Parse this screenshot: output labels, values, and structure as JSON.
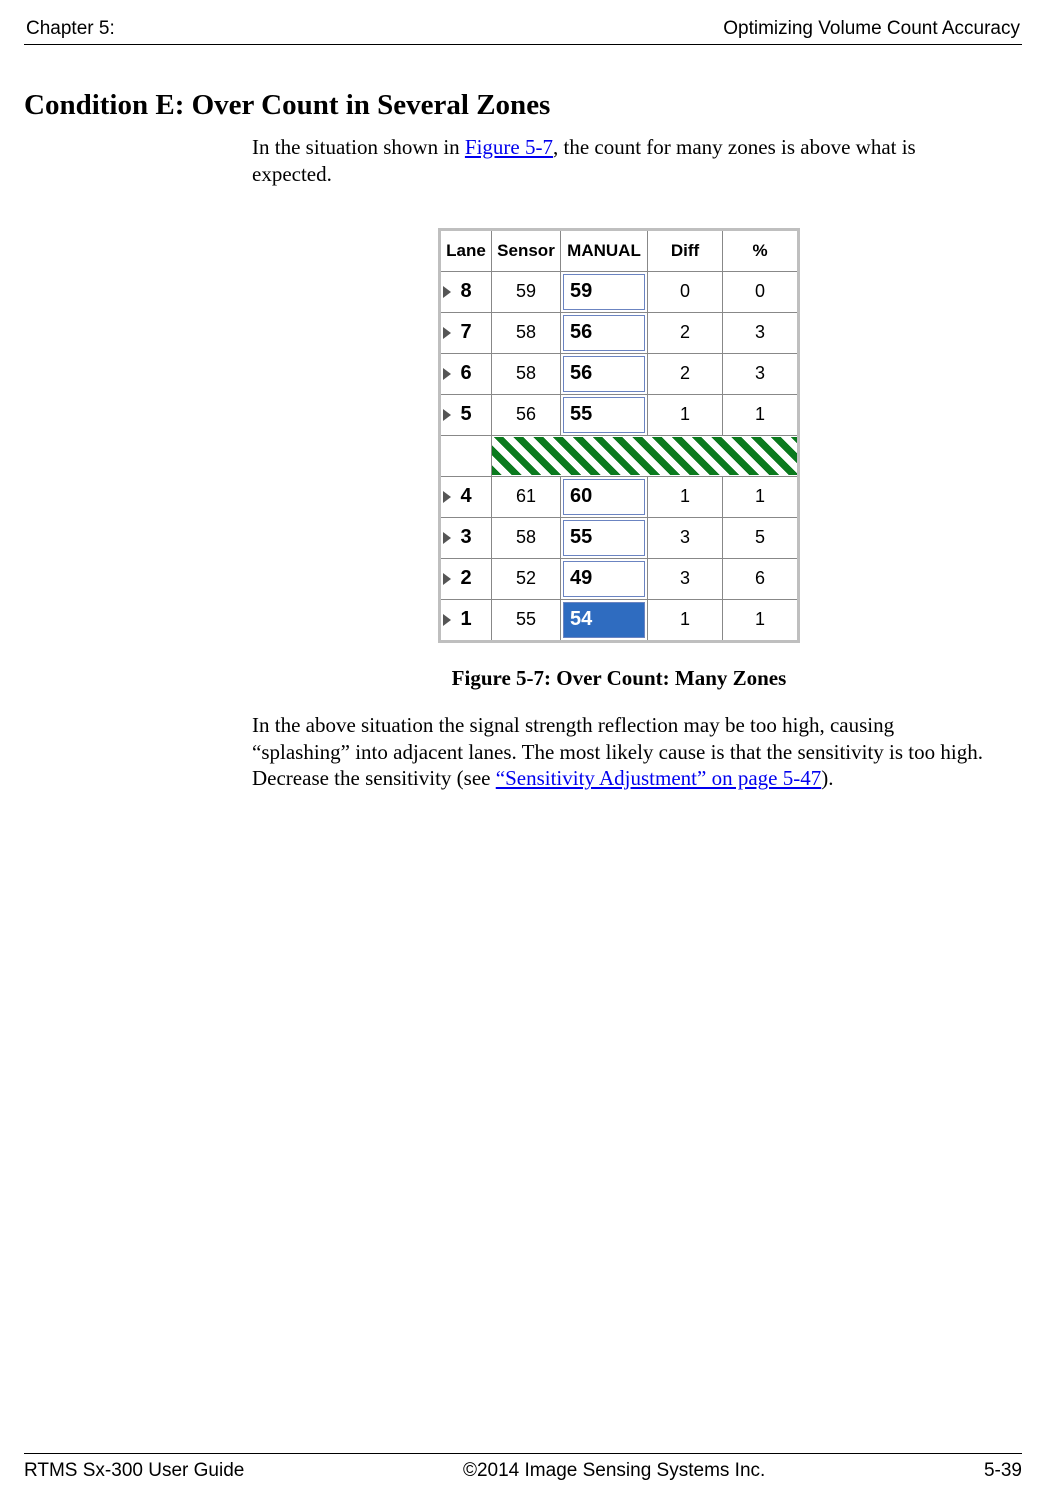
{
  "header": {
    "left": "Chapter 5:",
    "right": "Optimizing Volume Count Accuracy"
  },
  "heading": "Condition E: Over Count in Several Zones",
  "intro": {
    "pre": "In the situation shown in ",
    "link": "Figure 5-7",
    "post": ", the count for many zones is above what is expected."
  },
  "table": {
    "columns": {
      "lane": "Lane",
      "sensor": "Sensor",
      "manual": "MANUAL",
      "diff": "Diff",
      "pct": "%"
    },
    "upper": [
      {
        "lane": "8",
        "sensor": "59",
        "manual": "59",
        "diff": "0",
        "pct": "0"
      },
      {
        "lane": "7",
        "sensor": "58",
        "manual": "56",
        "diff": "2",
        "pct": "3"
      },
      {
        "lane": "6",
        "sensor": "58",
        "manual": "56",
        "diff": "2",
        "pct": "3"
      },
      {
        "lane": "5",
        "sensor": "56",
        "manual": "55",
        "diff": "1",
        "pct": "1"
      }
    ],
    "lower": [
      {
        "lane": "4",
        "sensor": "61",
        "manual": "60",
        "diff": "1",
        "pct": "1"
      },
      {
        "lane": "3",
        "sensor": "58",
        "manual": "55",
        "diff": "3",
        "pct": "5"
      },
      {
        "lane": "2",
        "sensor": "52",
        "manual": "49",
        "diff": "3",
        "pct": "6"
      },
      {
        "lane": "1",
        "sensor": "55",
        "manual": "54",
        "diff": "1",
        "pct": "1",
        "selected": true
      }
    ]
  },
  "caption": "Figure 5-7: Over Count: Many Zones",
  "para2": {
    "pre": "In the above situation the signal strength reflection may be too high, causing “splashing” into adjacent lanes. The most likely cause is that the sensitivity is too high. Decrease the sensitivity (see ",
    "link": "“Sensitivity Adjustment” on page 5-47",
    "post": ")."
  },
  "footer": {
    "left": "RTMS Sx-300 User Guide",
    "center": "©2014 Image Sensing Systems Inc.",
    "right": "5-39"
  }
}
